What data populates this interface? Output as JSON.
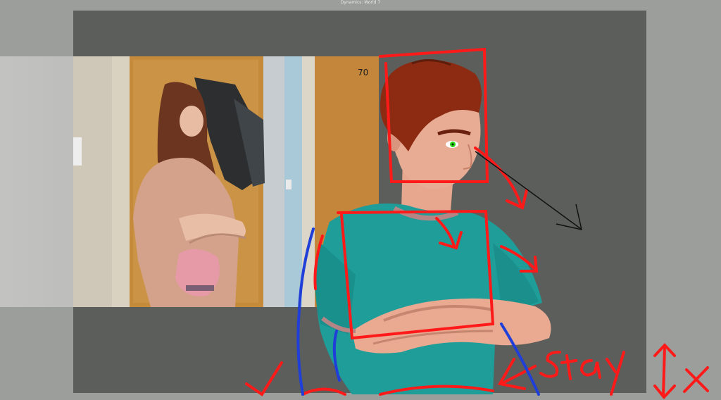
{
  "window": {
    "title": "Dynamics: World 7"
  },
  "viewport": {
    "frame_counter": "70"
  },
  "annotations": {
    "stay_label": "Stay"
  },
  "colors": {
    "viewport_bg": "#5c5e5c",
    "annotation_red": "#ff1a1a",
    "annotation_blue": "#1f3fd8",
    "character_shirt": "#1e9c98",
    "character_hair": "#8a2b10",
    "character_eye": "#2ad51c"
  },
  "icons": [
    "check-mark-annotation",
    "double-arrow-annotation",
    "x-annotation"
  ]
}
